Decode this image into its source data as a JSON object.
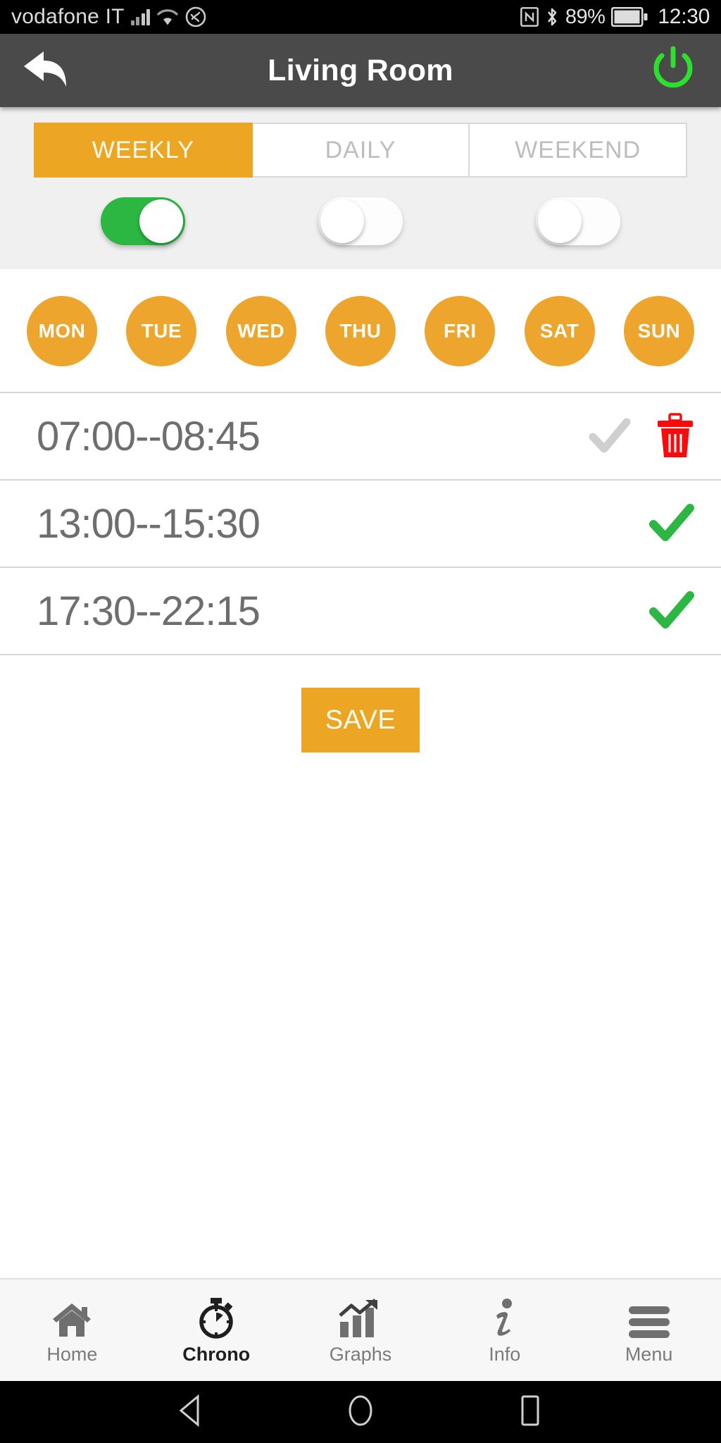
{
  "statusbar": {
    "carrier": "vodafone IT",
    "battery_percent": "89%",
    "time": "12:30",
    "icons": [
      "signal-icon",
      "wifi-icon",
      "shazam-icon",
      "nfc-icon",
      "bluetooth-icon",
      "battery-icon"
    ]
  },
  "header": {
    "title": "Living Room",
    "back_icon": "back-arrow-icon",
    "power_icon": "power-icon",
    "background_color": "#4a4a4a",
    "power_color": "#2EE02E"
  },
  "tabs": [
    {
      "label": "WEEKLY",
      "active": true
    },
    {
      "label": "DAILY",
      "active": false
    },
    {
      "label": "WEEKEND",
      "active": false
    }
  ],
  "toggles": [
    {
      "name": "weekly-toggle",
      "on": true
    },
    {
      "name": "daily-toggle",
      "on": false
    },
    {
      "name": "weekend-toggle",
      "on": false
    }
  ],
  "days": [
    {
      "label": "MON",
      "selected": true
    },
    {
      "label": "TUE",
      "selected": true
    },
    {
      "label": "WED",
      "selected": true
    },
    {
      "label": "THU",
      "selected": true
    },
    {
      "label": "FRI",
      "selected": true
    },
    {
      "label": "SAT",
      "selected": true
    },
    {
      "label": "SUN",
      "selected": true
    }
  ],
  "slots": [
    {
      "time": "07:00--08:45",
      "check_state": "inactive",
      "has_delete": true
    },
    {
      "time": "13:00--15:30",
      "check_state": "active",
      "has_delete": false
    },
    {
      "time": "17:30--22:15",
      "check_state": "active",
      "has_delete": false
    }
  ],
  "save": {
    "label": "SAVE"
  },
  "bottomnav": [
    {
      "label": "Home",
      "icon": "home-icon",
      "active": false
    },
    {
      "label": "Chrono",
      "icon": "stopwatch-icon",
      "active": true
    },
    {
      "label": "Graphs",
      "icon": "bar-chart-icon",
      "active": false
    },
    {
      "label": "Info",
      "icon": "info-icon",
      "active": false
    },
    {
      "label": "Menu",
      "icon": "hamburger-icon",
      "active": false
    }
  ],
  "androidnav": [
    "back-triangle-icon",
    "home-circle-icon",
    "recents-square-icon"
  ],
  "colors": {
    "accent_orange": "#EDA524",
    "day_orange": "#EDA52E",
    "green": "#2CB742",
    "power_green": "#2EE02E",
    "delete_red": "#FA0A0A",
    "text_gray": "#6E6E6E",
    "inactive_check": "#CFCFCF"
  }
}
